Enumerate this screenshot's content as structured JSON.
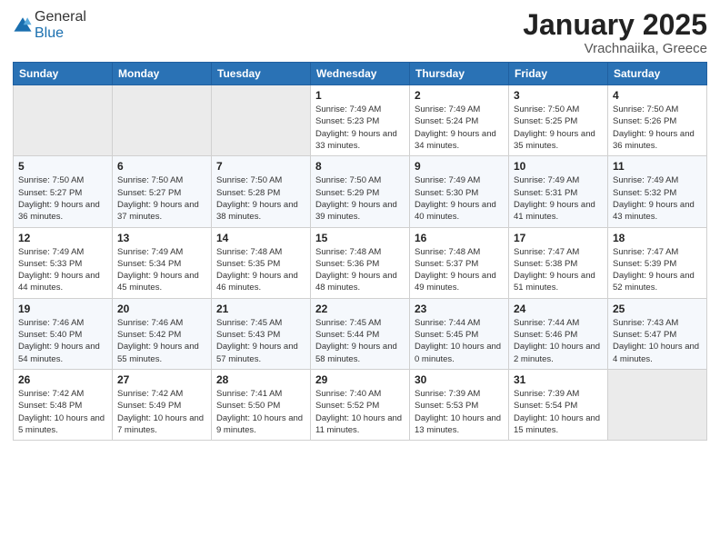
{
  "header": {
    "logo_general": "General",
    "logo_blue": "Blue",
    "title": "January 2025",
    "location": "Vrachnaiika, Greece"
  },
  "days_of_week": [
    "Sunday",
    "Monday",
    "Tuesday",
    "Wednesday",
    "Thursday",
    "Friday",
    "Saturday"
  ],
  "weeks": [
    [
      {
        "day": "",
        "empty": true
      },
      {
        "day": "",
        "empty": true
      },
      {
        "day": "",
        "empty": true
      },
      {
        "day": "1",
        "sunrise": "7:49 AM",
        "sunset": "5:23 PM",
        "daylight": "9 hours and 33 minutes."
      },
      {
        "day": "2",
        "sunrise": "7:49 AM",
        "sunset": "5:24 PM",
        "daylight": "9 hours and 34 minutes."
      },
      {
        "day": "3",
        "sunrise": "7:50 AM",
        "sunset": "5:25 PM",
        "daylight": "9 hours and 35 minutes."
      },
      {
        "day": "4",
        "sunrise": "7:50 AM",
        "sunset": "5:26 PM",
        "daylight": "9 hours and 36 minutes."
      }
    ],
    [
      {
        "day": "5",
        "sunrise": "7:50 AM",
        "sunset": "5:27 PM",
        "daylight": "9 hours and 36 minutes."
      },
      {
        "day": "6",
        "sunrise": "7:50 AM",
        "sunset": "5:27 PM",
        "daylight": "9 hours and 37 minutes."
      },
      {
        "day": "7",
        "sunrise": "7:50 AM",
        "sunset": "5:28 PM",
        "daylight": "9 hours and 38 minutes."
      },
      {
        "day": "8",
        "sunrise": "7:50 AM",
        "sunset": "5:29 PM",
        "daylight": "9 hours and 39 minutes."
      },
      {
        "day": "9",
        "sunrise": "7:49 AM",
        "sunset": "5:30 PM",
        "daylight": "9 hours and 40 minutes."
      },
      {
        "day": "10",
        "sunrise": "7:49 AM",
        "sunset": "5:31 PM",
        "daylight": "9 hours and 41 minutes."
      },
      {
        "day": "11",
        "sunrise": "7:49 AM",
        "sunset": "5:32 PM",
        "daylight": "9 hours and 43 minutes."
      }
    ],
    [
      {
        "day": "12",
        "sunrise": "7:49 AM",
        "sunset": "5:33 PM",
        "daylight": "9 hours and 44 minutes."
      },
      {
        "day": "13",
        "sunrise": "7:49 AM",
        "sunset": "5:34 PM",
        "daylight": "9 hours and 45 minutes."
      },
      {
        "day": "14",
        "sunrise": "7:48 AM",
        "sunset": "5:35 PM",
        "daylight": "9 hours and 46 minutes."
      },
      {
        "day": "15",
        "sunrise": "7:48 AM",
        "sunset": "5:36 PM",
        "daylight": "9 hours and 48 minutes."
      },
      {
        "day": "16",
        "sunrise": "7:48 AM",
        "sunset": "5:37 PM",
        "daylight": "9 hours and 49 minutes."
      },
      {
        "day": "17",
        "sunrise": "7:47 AM",
        "sunset": "5:38 PM",
        "daylight": "9 hours and 51 minutes."
      },
      {
        "day": "18",
        "sunrise": "7:47 AM",
        "sunset": "5:39 PM",
        "daylight": "9 hours and 52 minutes."
      }
    ],
    [
      {
        "day": "19",
        "sunrise": "7:46 AM",
        "sunset": "5:40 PM",
        "daylight": "9 hours and 54 minutes."
      },
      {
        "day": "20",
        "sunrise": "7:46 AM",
        "sunset": "5:42 PM",
        "daylight": "9 hours and 55 minutes."
      },
      {
        "day": "21",
        "sunrise": "7:45 AM",
        "sunset": "5:43 PM",
        "daylight": "9 hours and 57 minutes."
      },
      {
        "day": "22",
        "sunrise": "7:45 AM",
        "sunset": "5:44 PM",
        "daylight": "9 hours and 58 minutes."
      },
      {
        "day": "23",
        "sunrise": "7:44 AM",
        "sunset": "5:45 PM",
        "daylight": "10 hours and 0 minutes."
      },
      {
        "day": "24",
        "sunrise": "7:44 AM",
        "sunset": "5:46 PM",
        "daylight": "10 hours and 2 minutes."
      },
      {
        "day": "25",
        "sunrise": "7:43 AM",
        "sunset": "5:47 PM",
        "daylight": "10 hours and 4 minutes."
      }
    ],
    [
      {
        "day": "26",
        "sunrise": "7:42 AM",
        "sunset": "5:48 PM",
        "daylight": "10 hours and 5 minutes."
      },
      {
        "day": "27",
        "sunrise": "7:42 AM",
        "sunset": "5:49 PM",
        "daylight": "10 hours and 7 minutes."
      },
      {
        "day": "28",
        "sunrise": "7:41 AM",
        "sunset": "5:50 PM",
        "daylight": "10 hours and 9 minutes."
      },
      {
        "day": "29",
        "sunrise": "7:40 AM",
        "sunset": "5:52 PM",
        "daylight": "10 hours and 11 minutes."
      },
      {
        "day": "30",
        "sunrise": "7:39 AM",
        "sunset": "5:53 PM",
        "daylight": "10 hours and 13 minutes."
      },
      {
        "day": "31",
        "sunrise": "7:39 AM",
        "sunset": "5:54 PM",
        "daylight": "10 hours and 15 minutes."
      },
      {
        "day": "",
        "empty": true
      }
    ]
  ],
  "labels": {
    "sunrise": "Sunrise:",
    "sunset": "Sunset:",
    "daylight": "Daylight hours"
  }
}
